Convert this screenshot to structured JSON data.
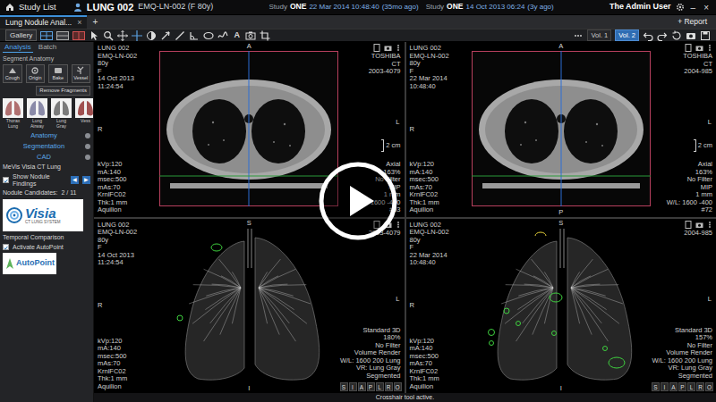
{
  "top_bar": {
    "home_label": "Study List",
    "patient": "LUNG 002",
    "patient_info": "EMQ-LN-002 (F 80y)",
    "studies": [
      {
        "label": "Study",
        "name": "ONE",
        "date": "22 Mar 2014 10:48:40",
        "age": "(35mo ago)"
      },
      {
        "label": "Study",
        "name": "ONE",
        "date": "14 Oct 2013 06:24",
        "age": "(3y ago)"
      }
    ],
    "user": "The Admin User",
    "minimize": "–",
    "close": "×"
  },
  "tab_bar": {
    "tabs": [
      {
        "label": "Lung Nodule Anal...",
        "close": "×",
        "selected": true
      }
    ],
    "add": "+",
    "report": "+ Report"
  },
  "toolbar": {
    "gallery": "Gallery",
    "text_tool": "A",
    "volumes": [
      {
        "label": "Vol. 1",
        "selected": false
      },
      {
        "label": "Vol. 2",
        "selected": true
      }
    ]
  },
  "sidebar": {
    "tabs": [
      {
        "label": "Analysis",
        "selected": true
      },
      {
        "label": "Batch",
        "selected": false
      }
    ],
    "section": "Segment Anatomy",
    "tools": [
      "Cough",
      "Origin",
      "Bake",
      "Vessel"
    ],
    "remove": "Remove Fragments",
    "presets": [
      "Thorax Lung",
      "Lung Airway",
      "Lung Gray",
      "Vess"
    ],
    "panels": [
      "Anatomy",
      "Segmentation",
      "CAD"
    ],
    "cad_title": "MeVis Visia CT Lung",
    "show_findings": {
      "label": "Show Nodule Findings",
      "checked": true
    },
    "nav": [
      "◀",
      "▶"
    ],
    "candidates": {
      "label": "Nodule Candidates:",
      "value": "2 / 11"
    },
    "visia": {
      "name": "Visia",
      "tagline": "CT LUNG SYSTEM"
    },
    "temporal": "Temporal Comparison",
    "autopoint": {
      "label": "Activate AutoPoint",
      "checked": true
    },
    "autopoint_logo": "AutoPoint"
  },
  "viewports": [
    {
      "kind": "axial",
      "top_left": [
        "LUNG 002",
        "EMQ-LN-002",
        "80y",
        "F",
        "14 Oct 2013",
        "11:24:54"
      ],
      "top_right": [
        "TOSHIBA",
        "CT",
        "2003-4079"
      ],
      "bottom_left": [
        "kVp:120",
        "mA:140",
        "msec:500",
        "mAs:70",
        "KrnlFC02",
        "Thk:1 mm",
        "Aquilion"
      ],
      "bottom_right": [
        "Axial",
        "163%",
        "No Filter",
        "MIP",
        "1 mm",
        "W/L: 1600 -400",
        "#63"
      ],
      "markers": {
        "top": "A",
        "left": "R",
        "right": "L"
      },
      "scale": "2 cm"
    },
    {
      "kind": "axial",
      "top_left": [
        "LUNG 002",
        "EMQ-LN-002",
        "80y",
        "F",
        "22 Mar 2014",
        "10:48:40"
      ],
      "top_right": [
        "TOSHIBA",
        "CT",
        "2004-985"
      ],
      "bottom_left": [
        "kVp:120",
        "mA:140",
        "msec:500",
        "mAs:70",
        "KrnlFC02",
        "Thk:1 mm",
        "Aquilion"
      ],
      "bottom_right": [
        "Axial",
        "163%",
        "No Filter",
        "MIP",
        "1 mm",
        "W/L: 1600 -400",
        "#72"
      ],
      "markers": {
        "top": "A",
        "left": "R",
        "right": "L",
        "bottom": "P"
      },
      "scale": "2 cm"
    },
    {
      "kind": "render3d",
      "top_left": [
        "LUNG 002",
        "EMQ-LN-002",
        "80y",
        "F",
        "14 Oct 2013",
        "11:24:54"
      ],
      "top_right": [
        "2003-4079"
      ],
      "bottom_left": [
        "kVp:120",
        "mA:140",
        "msec:500",
        "mAs:70",
        "KrnlFC02",
        "Thk:1 mm",
        "Aquilion"
      ],
      "bottom_right": [
        "Standard 3D",
        "180%",
        "No Filter",
        "Volume Render",
        "W/L: 1600 200 Lung",
        "VR: Lung Gray",
        "Segmented"
      ],
      "markers": {
        "top": "S",
        "left": "R",
        "right": "L",
        "bottom": "I"
      },
      "orient_keys": [
        "S",
        "I",
        "A",
        "P",
        "L",
        "R",
        "O"
      ]
    },
    {
      "kind": "render3d",
      "top_left": [
        "LUNG 002",
        "EMQ-LN-002",
        "80y",
        "F",
        "22 Mar 2014",
        "10:48:40"
      ],
      "top_right": [
        "2004-985"
      ],
      "bottom_left": [
        "kVp:120",
        "mA:140",
        "msec:500",
        "mAs:70",
        "KrnlFC02",
        "Thk:1 mm",
        "Aquilion"
      ],
      "bottom_right": [
        "Standard 3D",
        "157%",
        "No Filter",
        "Volume Render",
        "W/L: 1600 200 Lung",
        "VR: Lung Gray",
        "Segmented"
      ],
      "markers": {
        "top": "S",
        "left": "R",
        "right": "L",
        "bottom": "I"
      },
      "orient_keys": [
        "S",
        "I",
        "A",
        "P",
        "L",
        "R",
        "O"
      ]
    }
  ],
  "status_bar": {
    "text": "Crosshair tool active."
  }
}
